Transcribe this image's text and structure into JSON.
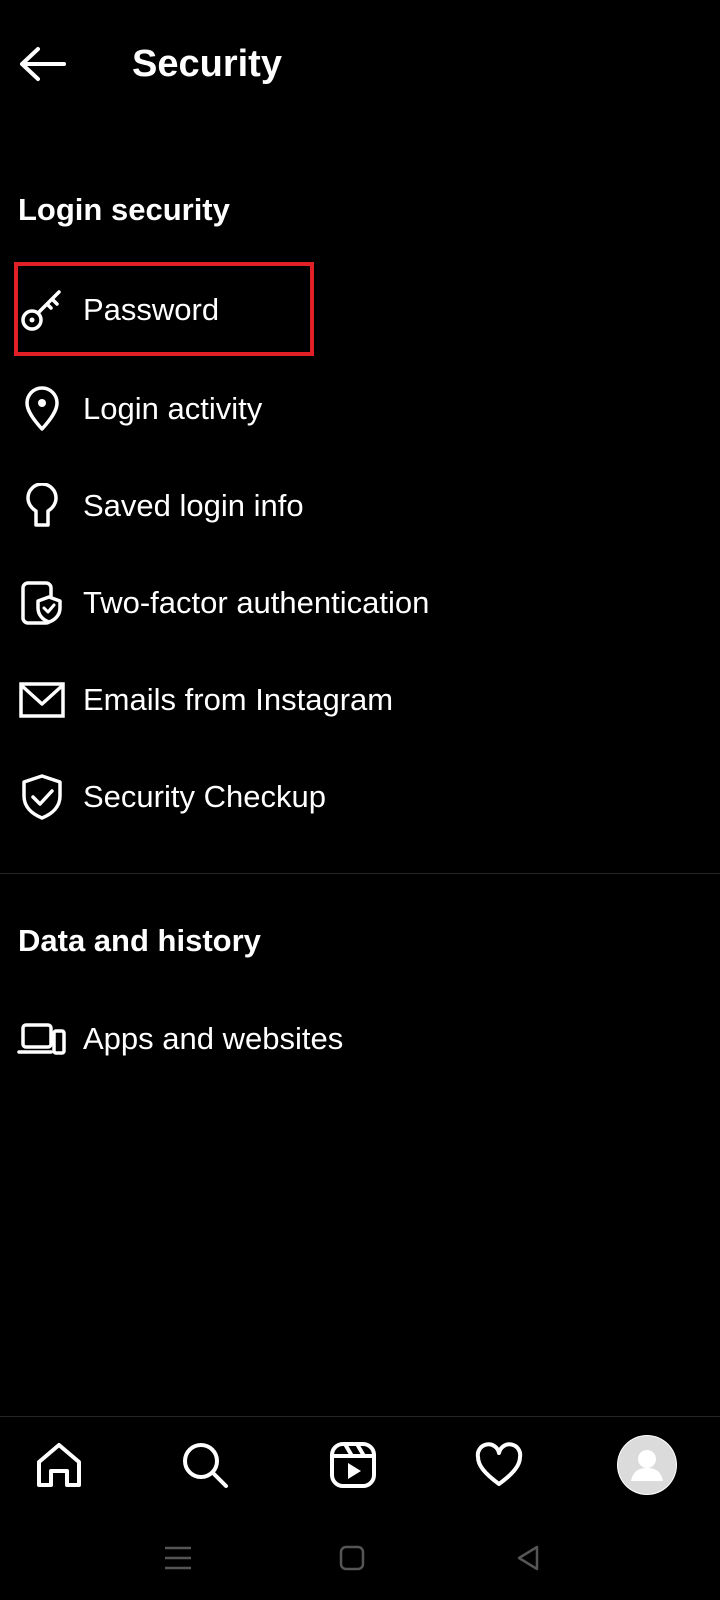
{
  "header": {
    "title": "Security"
  },
  "sections": [
    {
      "title": "Login security",
      "items": [
        {
          "label": "Password",
          "icon": "key-icon"
        },
        {
          "label": "Login activity",
          "icon": "location-pin-icon"
        },
        {
          "label": "Saved login info",
          "icon": "keyhole-icon"
        },
        {
          "label": "Two-factor authentication",
          "icon": "phone-shield-icon"
        },
        {
          "label": "Emails from Instagram",
          "icon": "mail-icon"
        },
        {
          "label": "Security Checkup",
          "icon": "shield-check-icon"
        }
      ]
    },
    {
      "title": "Data and history",
      "items": [
        {
          "label": "Apps and websites",
          "icon": "devices-icon"
        }
      ]
    }
  ],
  "tabbar": {
    "tabs": [
      "home-icon",
      "search-icon",
      "reels-icon",
      "heart-icon",
      "profile-avatar"
    ]
  },
  "colors": {
    "background": "#000000",
    "text": "#ffffff",
    "highlight": "#e01f26",
    "divider": "#262626"
  }
}
